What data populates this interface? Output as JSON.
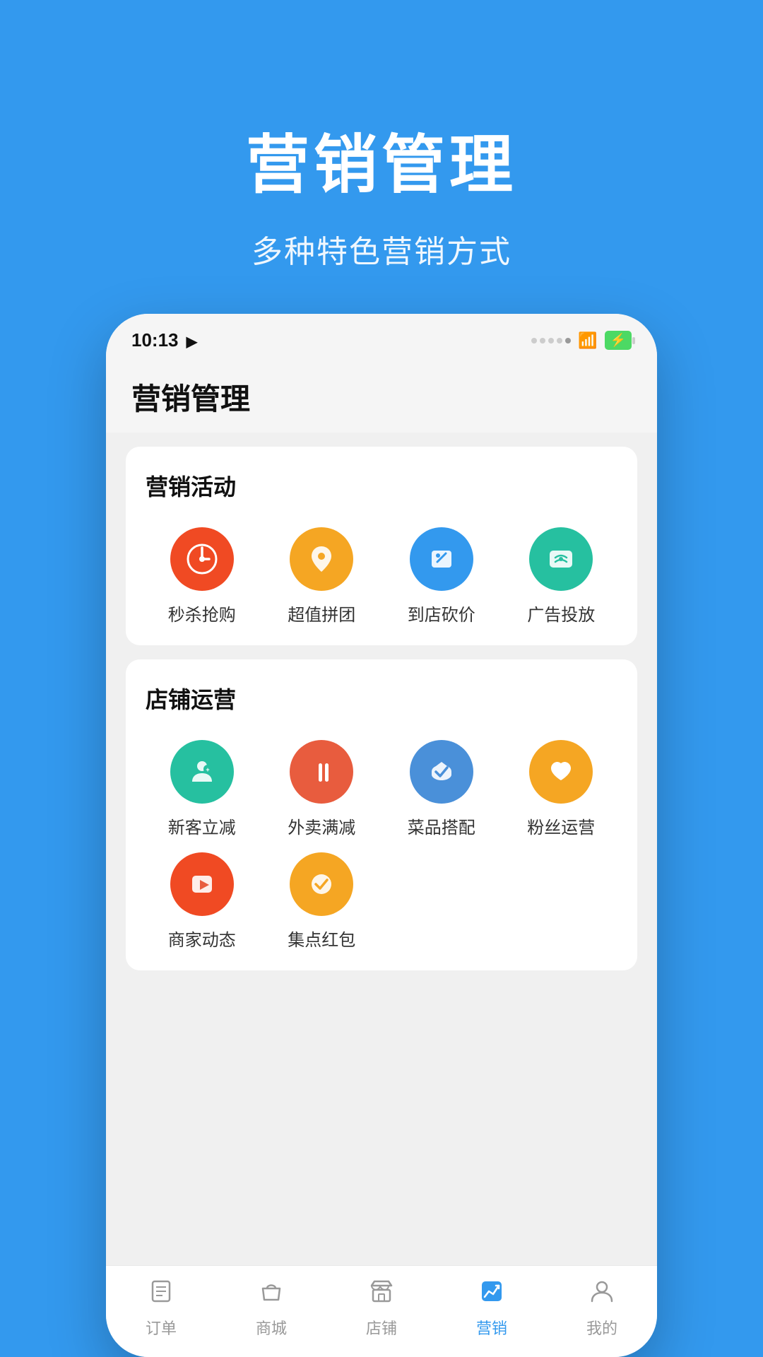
{
  "background_color": "#3399ee",
  "hero": {
    "title": "营销管理",
    "subtitle": "多种特色营销方式"
  },
  "phone": {
    "status_bar": {
      "time": "10:13",
      "signal_label": "signal",
      "wifi_label": "wifi",
      "battery_label": "charging"
    },
    "header": {
      "title": "营销管理"
    },
    "sections": [
      {
        "id": "marketing-activities",
        "title": "营销活动",
        "items": [
          {
            "id": "flash-sale",
            "label": "秒杀抢购",
            "icon": "⚡",
            "color_class": "ic-red"
          },
          {
            "id": "group-buy",
            "label": "超值拼团",
            "icon": "✿",
            "color_class": "ic-orange"
          },
          {
            "id": "in-store-discount",
            "label": "到店砍价",
            "icon": "✏",
            "color_class": "ic-blue"
          },
          {
            "id": "ad-placement",
            "label": "广告投放",
            "icon": "💬",
            "color_class": "ic-teal"
          }
        ]
      },
      {
        "id": "store-operations",
        "title": "店铺运营",
        "items": [
          {
            "id": "new-customer-discount",
            "label": "新客立减",
            "icon": "👤",
            "color_class": "ic-teal"
          },
          {
            "id": "delivery-discount",
            "label": "外卖满减",
            "icon": "🍽",
            "color_class": "ic-redorange"
          },
          {
            "id": "dish-pairing",
            "label": "菜品搭配",
            "icon": "👍",
            "color_class": "ic-blue2"
          },
          {
            "id": "fan-operations",
            "label": "粉丝运营",
            "icon": "♥",
            "color_class": "ic-orange"
          },
          {
            "id": "merchant-dynamics",
            "label": "商家动态",
            "icon": "▶",
            "color_class": "ic-red"
          },
          {
            "id": "point-red-packet",
            "label": "集点红包",
            "icon": "✔",
            "color_class": "ic-yellow"
          }
        ]
      }
    ],
    "bottom_nav": {
      "items": [
        {
          "id": "orders",
          "label": "订单",
          "icon": "📋",
          "active": false
        },
        {
          "id": "mall",
          "label": "商城",
          "icon": "🛍",
          "active": false
        },
        {
          "id": "store",
          "label": "店铺",
          "icon": "🏪",
          "active": false
        },
        {
          "id": "marketing",
          "label": "营销",
          "icon": "📈",
          "active": true
        },
        {
          "id": "mine",
          "label": "我的",
          "icon": "👤",
          "active": false
        }
      ]
    }
  }
}
